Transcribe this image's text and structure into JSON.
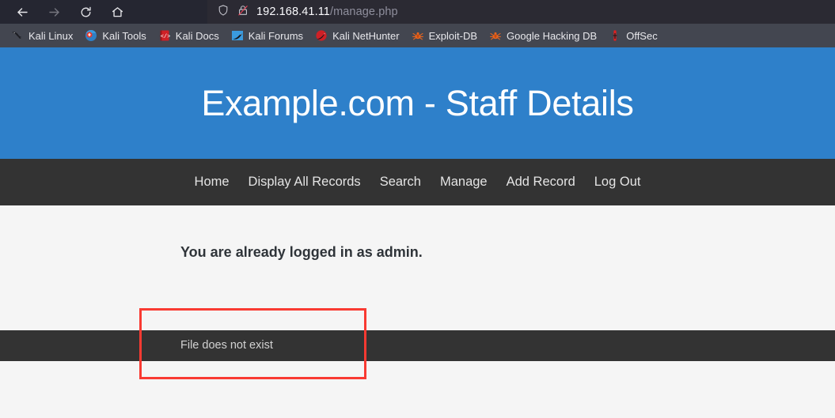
{
  "browser": {
    "nav": {
      "back_icon": "arrow-left-icon",
      "forward_icon": "arrow-right-icon",
      "reload_icon": "reload-icon",
      "home_icon": "home-icon"
    },
    "urlbar": {
      "shield_icon": "shield-icon",
      "security_icon": "padlock-crossed-icon",
      "host": "192.168.41.11",
      "path": "/manage.php"
    },
    "bookmarks": [
      {
        "label": "Kali Linux",
        "icon": "kali-dragon-icon"
      },
      {
        "label": "Kali Tools",
        "icon": "kali-tools-icon"
      },
      {
        "label": "Kali Docs",
        "icon": "kali-docs-icon"
      },
      {
        "label": "Kali Forums",
        "icon": "kali-forums-icon"
      },
      {
        "label": "Kali NetHunter",
        "icon": "kali-nethunter-icon"
      },
      {
        "label": "Exploit-DB",
        "icon": "exploit-db-icon"
      },
      {
        "label": "Google Hacking DB",
        "icon": "google-hacking-db-icon"
      },
      {
        "label": "OffSec",
        "icon": "offsec-icon"
      }
    ]
  },
  "page": {
    "header_title": "Example.com - Staff Details",
    "nav_links": [
      "Home",
      "Display All Records",
      "Search",
      "Manage",
      "Add Record",
      "Log Out"
    ],
    "login_message": "You are already logged in as admin.",
    "footer_message": "File does not exist"
  },
  "colors": {
    "header_blue": "#2e80ca",
    "navbar_dark": "#333333",
    "body_bg": "#f5f5f5",
    "annotation_red": "#f93a32",
    "toolbar_bg": "#252631",
    "bookmarks_bg": "#434650"
  }
}
